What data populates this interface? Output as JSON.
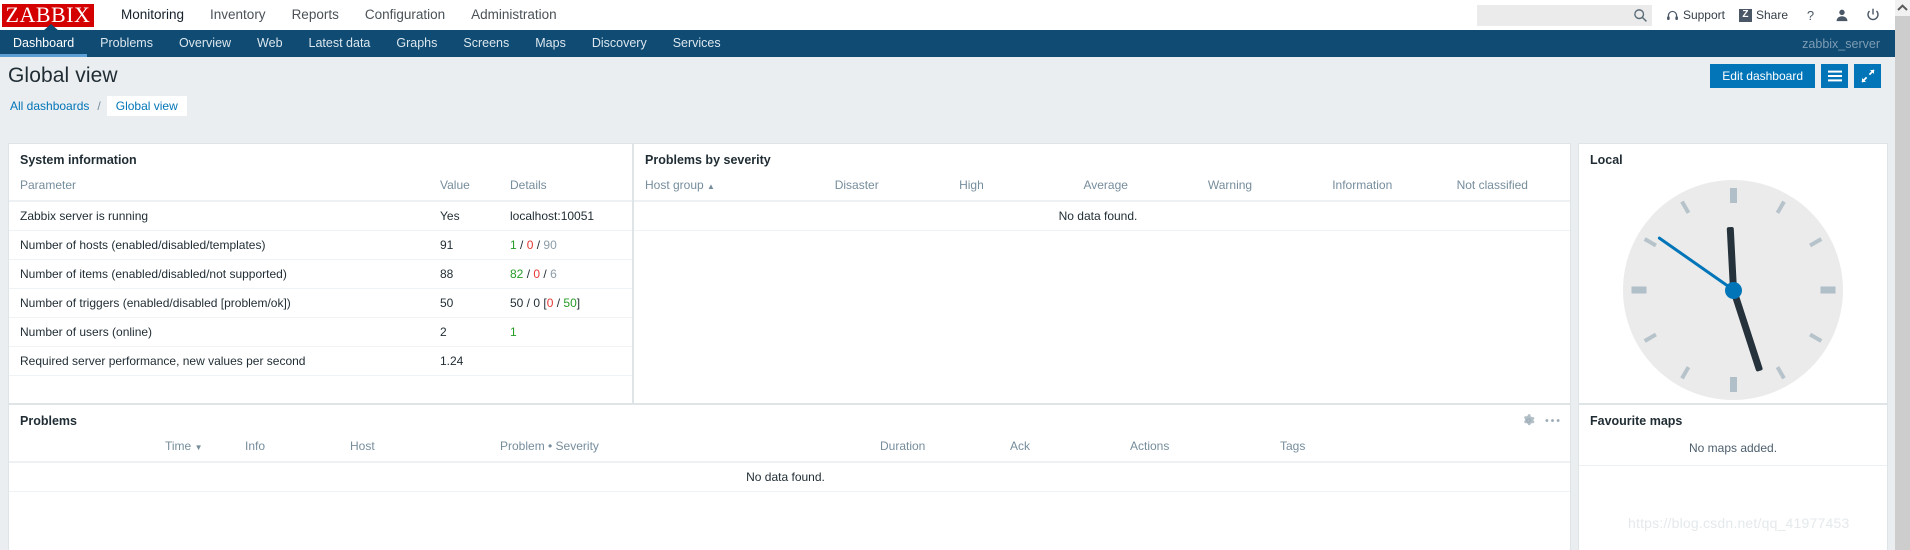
{
  "app": {
    "logo_text": "ZABBIX",
    "server_name": "zabbix_server",
    "watermark": "https://blog.csdn.net/qq_41977453"
  },
  "main_nav": {
    "items": [
      {
        "label": "Monitoring",
        "active": true
      },
      {
        "label": "Inventory",
        "active": false
      },
      {
        "label": "Reports",
        "active": false
      },
      {
        "label": "Configuration",
        "active": false
      },
      {
        "label": "Administration",
        "active": false
      }
    ]
  },
  "header_actions": {
    "search_placeholder": "",
    "search_value": "",
    "search_icon": "search-icon",
    "support_label": "Support",
    "support_icon": "headset-icon",
    "share_label": "Share",
    "share_icon": "zabbix-share-icon",
    "help_icon": "question-mark-icon",
    "user_icon": "user-profile-icon",
    "signout_icon": "power-icon"
  },
  "sub_nav": {
    "items": [
      {
        "label": "Dashboard",
        "active": true
      },
      {
        "label": "Problems",
        "active": false
      },
      {
        "label": "Overview",
        "active": false
      },
      {
        "label": "Web",
        "active": false
      },
      {
        "label": "Latest data",
        "active": false
      },
      {
        "label": "Graphs",
        "active": false
      },
      {
        "label": "Screens",
        "active": false
      },
      {
        "label": "Maps",
        "active": false
      },
      {
        "label": "Discovery",
        "active": false
      },
      {
        "label": "Services",
        "active": false
      }
    ]
  },
  "page": {
    "title": "Global view",
    "edit_dashboard_label": "Edit dashboard",
    "menu_icon": "hamburger-menu-icon",
    "fullscreen_icon": "expand-fullscreen-icon"
  },
  "breadcrumb": {
    "all_dashboards": "All dashboards",
    "separator": "/",
    "current": "Global view"
  },
  "system_information": {
    "title": "System information",
    "columns": [
      "Parameter",
      "Value",
      "Details"
    ],
    "rows": [
      {
        "parameter": "Zabbix server is running",
        "value": "Yes",
        "value_color": "green",
        "details_parts": [
          {
            "text": "localhost:10051",
            "color": "default"
          }
        ]
      },
      {
        "parameter": "Number of hosts (enabled/disabled/templates)",
        "value": "91",
        "value_color": "default",
        "details_parts": [
          {
            "text": "1",
            "color": "green"
          },
          {
            "text": " / ",
            "color": "default"
          },
          {
            "text": "0",
            "color": "red"
          },
          {
            "text": " / ",
            "color": "default"
          },
          {
            "text": "90",
            "color": "grey"
          }
        ]
      },
      {
        "parameter": "Number of items (enabled/disabled/not supported)",
        "value": "88",
        "value_color": "default",
        "details_parts": [
          {
            "text": "82",
            "color": "green"
          },
          {
            "text": " / ",
            "color": "default"
          },
          {
            "text": "0",
            "color": "red"
          },
          {
            "text": " / ",
            "color": "default"
          },
          {
            "text": "6",
            "color": "grey"
          }
        ]
      },
      {
        "parameter": "Number of triggers (enabled/disabled [problem/ok])",
        "value": "50",
        "value_color": "default",
        "details_parts": [
          {
            "text": "50 / 0 [",
            "color": "default"
          },
          {
            "text": "0",
            "color": "red"
          },
          {
            "text": " / ",
            "color": "default"
          },
          {
            "text": "50",
            "color": "green"
          },
          {
            "text": "]",
            "color": "default"
          }
        ]
      },
      {
        "parameter": "Number of users (online)",
        "value": "2",
        "value_color": "default",
        "details_parts": [
          {
            "text": "1",
            "color": "green"
          }
        ]
      },
      {
        "parameter": "Required server performance, new values per second",
        "value": "1.24",
        "value_color": "default",
        "details_parts": []
      }
    ]
  },
  "problems_by_severity": {
    "title": "Problems by severity",
    "columns": [
      "Host group",
      "Disaster",
      "High",
      "Average",
      "Warning",
      "Information",
      "Not classified"
    ],
    "sort_column": "Host group",
    "sort_direction_icon": "sort-ascending-icon",
    "empty_message": "No data found."
  },
  "clock": {
    "title": "Local",
    "hour_angle": 357,
    "minute_angle": 162,
    "second_angle": 305
  },
  "problems": {
    "title": "Problems",
    "columns": [
      "Time",
      "Info",
      "Host",
      "Problem • Severity",
      "Duration",
      "Ack",
      "Actions",
      "Tags"
    ],
    "sort_column": "Time",
    "sort_direction_icon": "sort-descending-icon",
    "empty_message": "No data found.",
    "gear_icon": "gear-icon",
    "more_icon": "ellipsis-icon"
  },
  "favourite_maps": {
    "title": "Favourite maps",
    "empty_message": "No maps added."
  },
  "colors": {
    "brand_red": "#d40000",
    "nav_blue": "#0f4b72",
    "accent_blue": "#0275b8",
    "page_bg": "#eaeef1",
    "green": "#249c25",
    "red": "#e33734",
    "grey": "#8b9ca8"
  }
}
